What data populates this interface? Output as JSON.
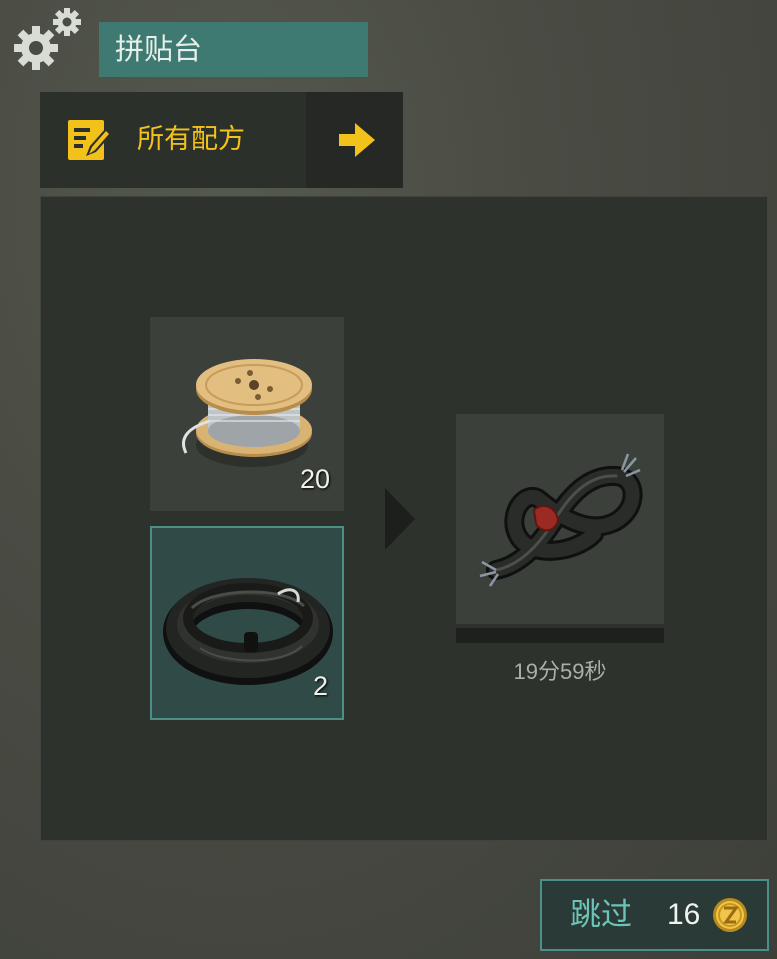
{
  "header": {
    "settings_icon": "gears-icon",
    "title": "拼贴台"
  },
  "recipes_tab": {
    "icon": "recipe-note-icon",
    "label": "所有配方",
    "arrow_icon": "arrow-right-icon"
  },
  "ingredients": [
    {
      "item": "wire-spool-icon",
      "count": "20",
      "selected": false
    },
    {
      "item": "rubber-hose-icon",
      "count": "2",
      "selected": true
    }
  ],
  "result": {
    "item": "wire-bundle-icon",
    "progress_fraction": 0.0,
    "timer": "19分59秒"
  },
  "skip": {
    "label": "跳过",
    "cost": "16",
    "currency_icon": "coin-icon"
  },
  "colors": {
    "accent_teal": "#4b8f86",
    "title_bar": "#3f7a72",
    "highlight_yellow": "#f2c21a"
  }
}
